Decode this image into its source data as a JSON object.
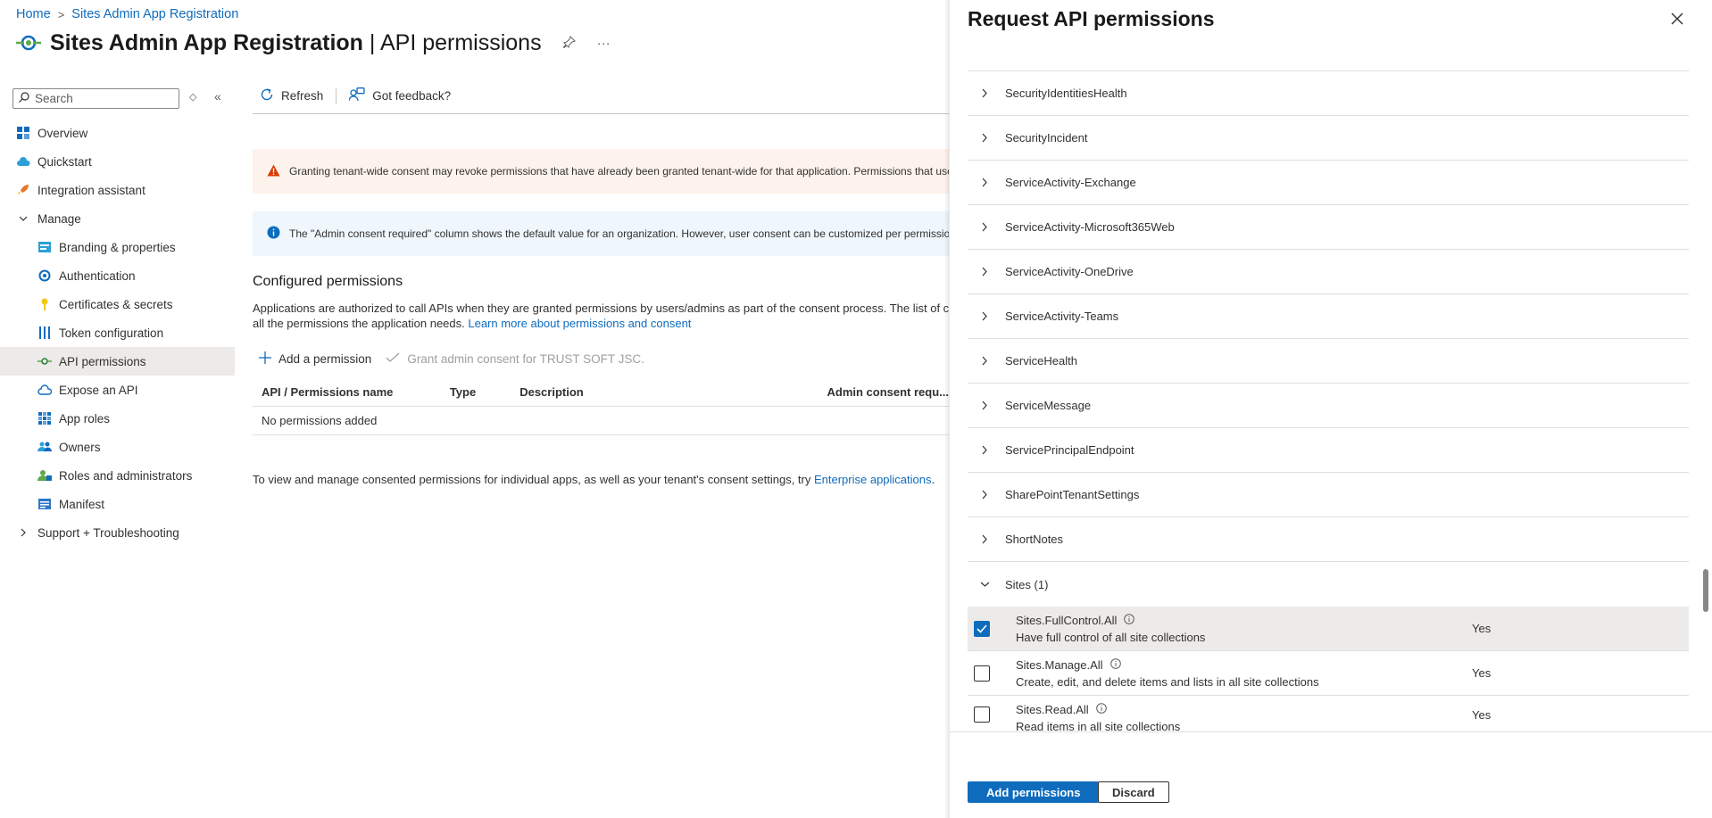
{
  "breadcrumb": {
    "home": "Home",
    "current": "Sites Admin App Registration"
  },
  "page": {
    "title_main": "Sites Admin App Registration",
    "title_sep": " | ",
    "title_sub": "API permissions"
  },
  "search": {
    "placeholder": "Search",
    "value": ""
  },
  "sidebar": {
    "items": [
      {
        "label": "Overview",
        "icon": "overview-icon"
      },
      {
        "label": "Quickstart",
        "icon": "quickstart-cloud-icon"
      },
      {
        "label": "Integration assistant",
        "icon": "rocket-icon"
      },
      {
        "label": "Manage",
        "icon": "chevron-down-icon"
      },
      {
        "label": "Branding & properties",
        "icon": "branding-icon"
      },
      {
        "label": "Authentication",
        "icon": "authentication-icon"
      },
      {
        "label": "Certificates & secrets",
        "icon": "key-icon"
      },
      {
        "label": "Token configuration",
        "icon": "token-bars-icon"
      },
      {
        "label": "API permissions",
        "icon": "api-permissions-icon"
      },
      {
        "label": "Expose an API",
        "icon": "cloud-icon"
      },
      {
        "label": "App roles",
        "icon": "grid-icon"
      },
      {
        "label": "Owners",
        "icon": "people-icon"
      },
      {
        "label": "Roles and administrators",
        "icon": "roles-icon"
      },
      {
        "label": "Manifest",
        "icon": "manifest-icon"
      },
      {
        "label": "Support + Troubleshooting",
        "icon": "chevron-right-icon"
      }
    ]
  },
  "toolbar": {
    "refresh": "Refresh",
    "feedback": "Got feedback?"
  },
  "banners": {
    "warning": "Granting tenant-wide consent may revoke permissions that have already been granted tenant-wide for that application. Permissions that users have already granted on their own behalf aren't affected.",
    "info": "The \"Admin consent required\" column shows the default value for an organization. However, user consent can be customized per permission, user, or app."
  },
  "configured": {
    "title": "Configured permissions",
    "desc_line1": "Applications are authorized to call APIs when they are granted permissions by users/admins as part of the consent process. The list of configured permissions should include",
    "desc_line2": "all the permissions the application needs. ",
    "learn_more": "Learn more about permissions and consent",
    "add_permission": "Add a permission",
    "grant_consent": "Grant admin consent for TRUST SOFT JSC.",
    "columns": [
      "API / Permissions name",
      "Type",
      "Description",
      "Admin consent requ..."
    ],
    "empty": "No permissions added",
    "footer": "To view and manage consented permissions for individual apps, as well as your tenant's consent settings, try ",
    "footer_link": "Enterprise applications",
    "footer_end": "."
  },
  "panel": {
    "title": "Request API permissions",
    "groups": [
      "SecurityIdentitiesHealth",
      "SecurityIncident",
      "ServiceActivity-Exchange",
      "ServiceActivity-Microsoft365Web",
      "ServiceActivity-OneDrive",
      "ServiceActivity-Teams",
      "ServiceHealth",
      "ServiceMessage",
      "ServicePrincipalEndpoint",
      "SharePointTenantSettings",
      "ShortNotes"
    ],
    "expanded_group": "Sites (1)",
    "permissions": [
      {
        "name": "Sites.FullControl.All",
        "desc": "Have full control of all site collections",
        "consent": "Yes",
        "checked": true
      },
      {
        "name": "Sites.Manage.All",
        "desc": "Create, edit, and delete items and lists in all site collections",
        "consent": "Yes",
        "checked": false
      },
      {
        "name": "Sites.Read.All",
        "desc": "Read items in all site collections",
        "consent": "Yes",
        "checked": false
      }
    ],
    "add_button": "Add permissions",
    "discard_button": "Discard"
  },
  "colors": {
    "accent": "#0f6cbd",
    "warning": "#d83b01",
    "selected_row": "#edebe9"
  }
}
